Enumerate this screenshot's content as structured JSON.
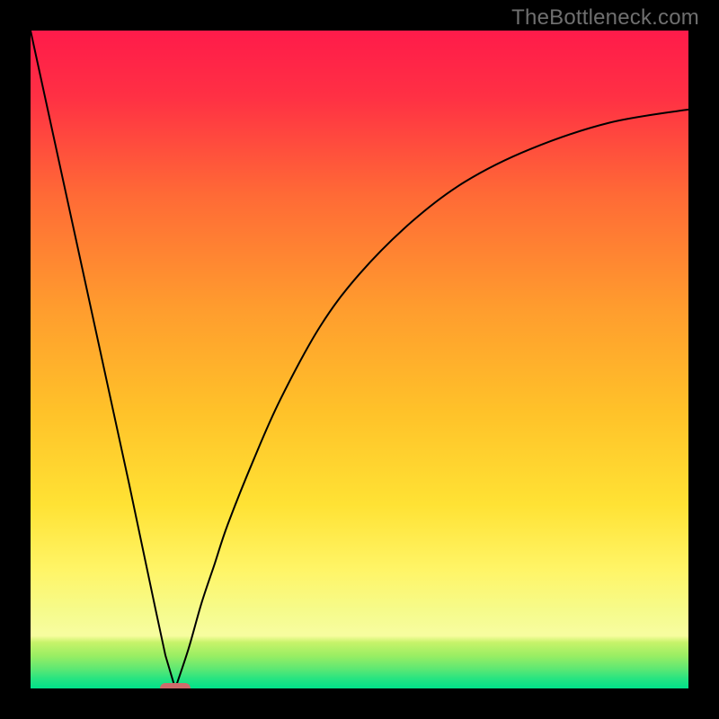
{
  "watermark": "TheBottleneck.com",
  "chart_data": {
    "type": "line",
    "title": "",
    "xlabel": "",
    "ylabel": "",
    "xlim": [
      0,
      100
    ],
    "ylim": [
      0,
      100
    ],
    "grid": false,
    "series": [
      {
        "name": "curve-left",
        "x": [
          0,
          5,
          10,
          15,
          19,
          20.5,
          22
        ],
        "values": [
          100,
          77,
          54,
          31,
          12,
          5,
          0
        ]
      },
      {
        "name": "curve-right",
        "x": [
          22,
          24,
          26,
          28,
          30,
          34,
          38,
          44,
          50,
          58,
          66,
          76,
          88,
          100
        ],
        "values": [
          0,
          6,
          13,
          19,
          25,
          35,
          44,
          55,
          63,
          71,
          77,
          82,
          86,
          88
        ]
      }
    ],
    "marker": {
      "x": 22,
      "y": 0,
      "color": "#cf6b6b",
      "shape": "rounded-dash"
    },
    "bottom_band": {
      "colors": [
        "#c7f36a",
        "#6ee76e",
        "#19e183",
        "#00e28a"
      ]
    }
  }
}
